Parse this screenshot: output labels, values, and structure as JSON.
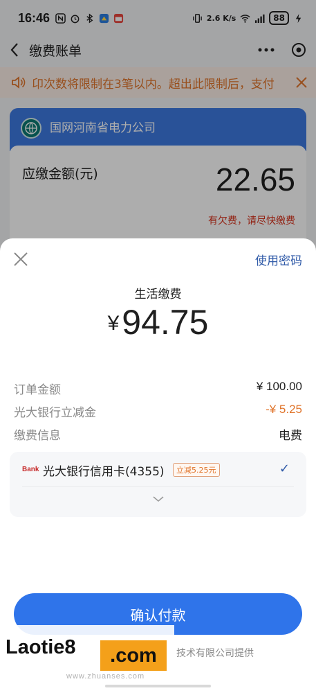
{
  "statusbar": {
    "time": "16:46",
    "network": "2.6 K/s",
    "battery": "88"
  },
  "nav": {
    "title": "缴费账单"
  },
  "notice": {
    "text": "卬次数将限制在3笔以内。超出此限制后，支付"
  },
  "bill": {
    "company": "国网河南省电力公司",
    "amount_label": "应缴金额(元)",
    "amount": "22.65",
    "arrears_text": "有欠费，请尽快缴费"
  },
  "sheet": {
    "use_password": "使用密码",
    "title": "生活缴费",
    "currency": "¥",
    "pay_amount": "94.75",
    "rows": [
      {
        "label": "订单金额",
        "value": "¥ 100.00"
      },
      {
        "label": "光大银行立减金",
        "value": "-¥ 5.25"
      },
      {
        "label": "缴费信息",
        "value": "电费"
      }
    ],
    "card": {
      "bank_logo": "Bank",
      "name": "光大银行信用卡(4355)",
      "promo": "立减5.25元"
    },
    "confirm_label": "确认付款",
    "provider": "技术有限公司提供"
  },
  "watermark": {
    "left": "Laotie8",
    "right": ".com",
    "sub": "www.zhuanses.com"
  },
  "colors": {
    "accent": "#2f74ea",
    "link": "#2f5aa8",
    "discount": "#e0752c",
    "arrears": "#d8331e",
    "biller_card": "#3d7ae0"
  }
}
